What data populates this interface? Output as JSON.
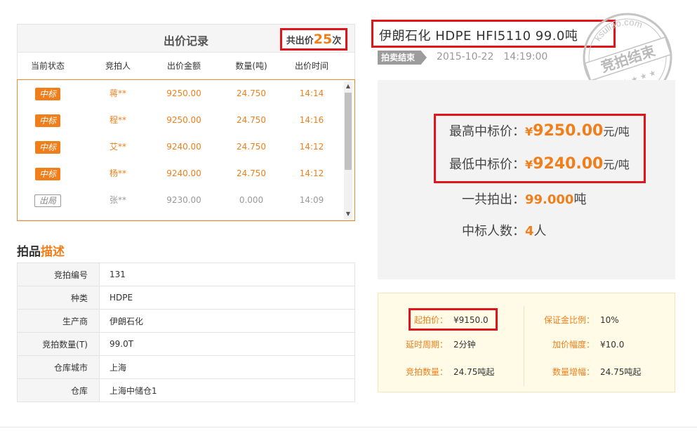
{
  "bid_record": {
    "title": "出价记录",
    "count_prefix": "共出价",
    "count": "25",
    "count_suffix": "次",
    "columns": [
      "当前状态",
      "竞拍人",
      "出价金额",
      "数量(吨)",
      "出价时间"
    ],
    "rows": [
      {
        "status": "中标",
        "bidder": "蒋**",
        "amount": "9250.00",
        "qty": "24.750",
        "time": "14:14"
      },
      {
        "status": "中标",
        "bidder": "程**",
        "amount": "9250.00",
        "qty": "24.750",
        "time": "14:16"
      },
      {
        "status": "中标",
        "bidder": "艾**",
        "amount": "9240.00",
        "qty": "24.750",
        "time": "14:12"
      },
      {
        "status": "中标",
        "bidder": "杨**",
        "amount": "9240.00",
        "qty": "24.750",
        "time": "14:12"
      },
      {
        "status": "出局",
        "bidder": "张**",
        "amount": "9230.00",
        "qty": "0.000",
        "time": "14:09"
      }
    ],
    "scroll_up": "▲",
    "scroll_down": "▼"
  },
  "description": {
    "heading_1": "拍品",
    "heading_2": "描述",
    "rows": [
      {
        "key": "竞拍编号",
        "value": "131"
      },
      {
        "key": "种类",
        "value": "HDPE"
      },
      {
        "key": "生产商",
        "value": "伊朗石化"
      },
      {
        "key": "竞拍数量(T)",
        "value": "99.0T"
      },
      {
        "key": "仓库城市",
        "value": "上海"
      },
      {
        "key": "仓库",
        "value": "上海中储仓1"
      }
    ]
  },
  "product": {
    "title": "伊朗石化   HDPE   HFI5110   99.0吨",
    "status": "拍卖结束",
    "end_date": "2015-10-22",
    "end_time": "14:19:00"
  },
  "stamp": {
    "text": "竞拍结束",
    "url": "ksuliao.com",
    "stars": "★ ★ ★ ★ ★"
  },
  "summary": {
    "max_label": "最高中标价：",
    "max_currency": "¥",
    "max_value": "9250.00",
    "max_unit": "元/吨",
    "min_label": "最低中标价：",
    "min_currency": "¥",
    "min_value": "9240.00",
    "min_unit": "元/吨",
    "total_label": "一共拍出：",
    "total_value": "99.000",
    "total_unit": "吨",
    "winners_label": "中标人数：",
    "winners_value": "4",
    "winners_unit": "人"
  },
  "rules": {
    "start_price_label": "起拍价：",
    "start_price_value": "¥9150.0",
    "deposit_label": "保证金比例：",
    "deposit_value": "10%",
    "delay_label": "延时周期：",
    "delay_value": "2分钟",
    "increment_label": "加价幅度：",
    "increment_value": "¥10.0",
    "bid_qty_label": "竞拍数量：",
    "bid_qty_value": "24.75吨起",
    "qty_step_label": "数量增幅：",
    "qty_step_value": "24.75吨起"
  },
  "colors": {
    "accent_orange": "#f07f1b",
    "highlight_red": "#e0141a",
    "stamp_gray": "#b9b9b9"
  }
}
